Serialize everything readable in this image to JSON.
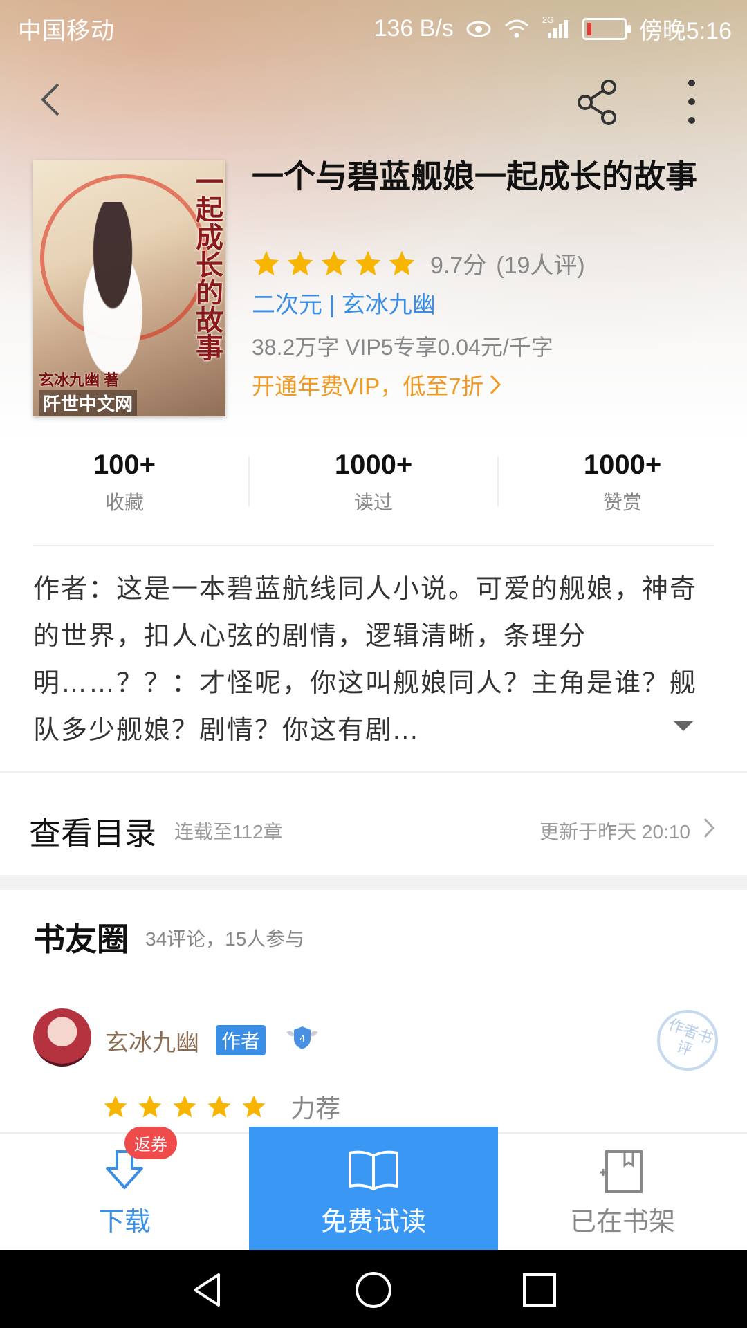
{
  "status_bar": {
    "carrier": "中国移动",
    "net_speed": "136 B/s",
    "network": "2G",
    "time": "傍晚5:16"
  },
  "book": {
    "title": "一个与碧蓝舰娘一起成长的故事",
    "cover_title": "一个与碧蓝舰娘一起成长的故事",
    "cover_author": "玄冰九幽 著",
    "cover_publisher": "阡世中文网",
    "rating_stars": 5,
    "score": "9.7分",
    "rating_count": "(19人评)",
    "tags": "二次元 | 玄冰九幽",
    "word_info": "38.2万字  VIP5专享0.04元/千字",
    "vip_promo": "开通年费VIP，低至7折"
  },
  "stats": [
    {
      "num": "100+",
      "label": "收藏"
    },
    {
      "num": "1000+",
      "label": "读过"
    },
    {
      "num": "1000+",
      "label": "赞赏"
    }
  ],
  "description": "作者：这是一本碧蓝航线同人小说。可爱的舰娘，神奇的世界，扣人心弦的剧情，逻辑清晰，条理分明……？？：才怪呢，你这叫舰娘同人？主角是谁？舰队多少舰娘？剧情？你这有剧...",
  "toc": {
    "label": "查看目录",
    "progress": "连载至112章",
    "updated": "更新于昨天 20:10"
  },
  "circle": {
    "title": "书友圈",
    "summary": "34评论，15人参与",
    "post": {
      "username": "玄冰九幽",
      "author_tag": "作者",
      "level": "4",
      "stamp": "作者书评",
      "stars": 5,
      "verdict": "力荐"
    }
  },
  "bottom_bar": {
    "download": "下载",
    "coupon": "返券",
    "free_read": "免费试读",
    "shelf": "已在书架"
  },
  "colors": {
    "accent_blue": "#3a98f4",
    "star_gold": "#f7b500",
    "promo_orange": "#f09a24",
    "coupon_red": "#f04b4b"
  }
}
